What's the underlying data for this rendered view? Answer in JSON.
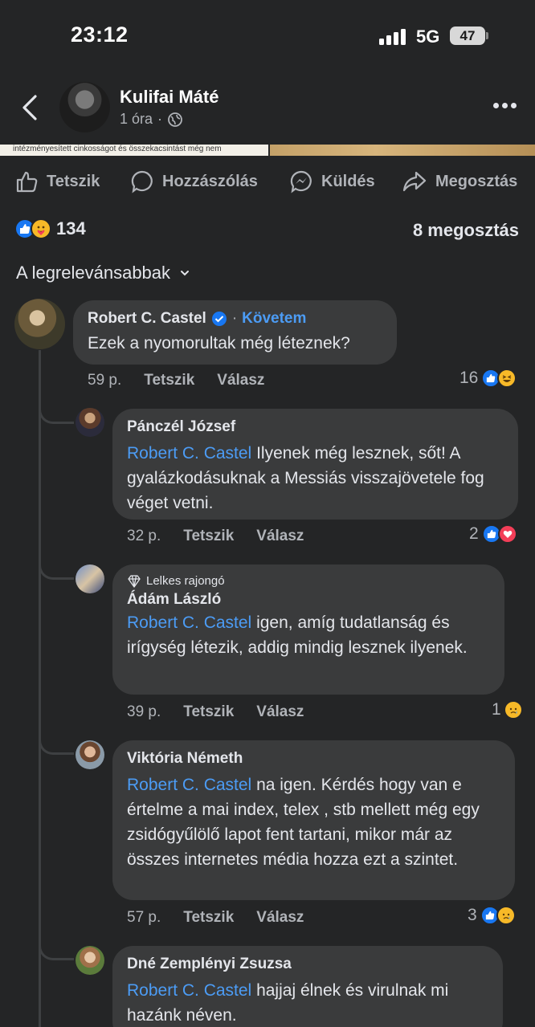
{
  "status_bar": {
    "time": "23:12",
    "network": "5G",
    "battery": "47"
  },
  "post": {
    "author": "Kulifai Máté",
    "time": "1 óra",
    "image_caption_fragment": "intézményesített cinkosságot és összekacsintást még nem"
  },
  "actions": {
    "like": "Tetszik",
    "comment": "Hozzászólás",
    "send": "Küldés",
    "share": "Megosztás"
  },
  "reactions": {
    "count": "134",
    "shares": "8 megosztás"
  },
  "sort": {
    "label": "A legrelevánsabbak"
  },
  "comments": [
    {
      "name": "Robert C. Castel",
      "follow": "Követem",
      "text": "Ezek a nyomorultak még léteznek?",
      "time": "59 p.",
      "like": "Tetszik",
      "reply": "Válasz",
      "reaction_count": "16"
    },
    {
      "name": "Pánczél József",
      "mention": "Robert C. Castel",
      "text": " Ilyenek még lesznek, sőt! A gyalázkodásuknak a Messiás visszajövetele fog véget vetni.",
      "time": "32 p.",
      "like": "Tetszik",
      "reply": "Válasz",
      "reaction_count": "2"
    },
    {
      "badge": "Lelkes rajongó",
      "name": "Ádám László",
      "mention": "Robert C. Castel",
      "text": " igen, amíg tudatlanság és irígység létezik, addig mindig lesznek ilyenek.",
      "time": "39 p.",
      "like": "Tetszik",
      "reply": "Válasz",
      "reaction_count": "1"
    },
    {
      "name": "Viktória Németh",
      "mention": "Robert C. Castel",
      "text": " na igen. Kérdés hogy van e értelme a mai index, telex , stb mellett még egy zsidógyűlölő lapot fent tartani, mikor már az összes internetes média hozza ezt a szintet.",
      "time": "57 p.",
      "like": "Tetszik",
      "reply": "Válasz",
      "reaction_count": "3"
    },
    {
      "name": "Dné Zemplényi Zsuzsa",
      "mention": "Robert C. Castel",
      "text": " hajjaj élnek és virulnak mi hazánk néven."
    }
  ],
  "colors": {
    "background": "#242526",
    "bubble": "#3a3b3c",
    "mention": "#4c9cf5",
    "like_blue": "#1877f2",
    "love_red": "#f33e58",
    "haha_yellow": "#f7b928"
  }
}
